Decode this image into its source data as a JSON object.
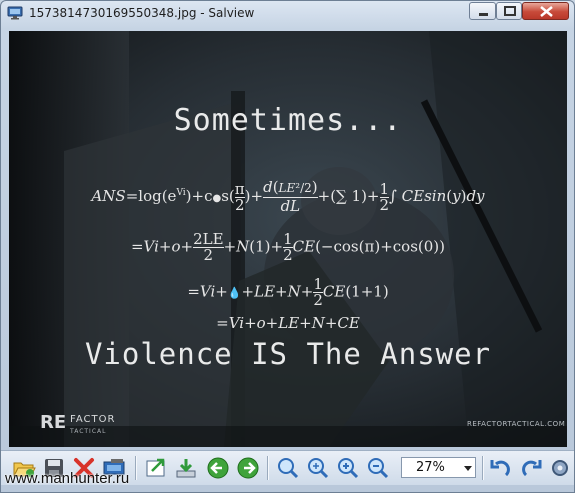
{
  "window": {
    "title": "1573814730169550348.jpg - Salview"
  },
  "image": {
    "headline_top": "Sometimes...",
    "math": {
      "line1_lhs": "ANS",
      "line2": "=Vi+o+",
      "line3": "=Vi+",
      "line4": "=Vi+o+LE+N+CE"
    },
    "headline_bottom": "Violence IS The Answer",
    "logo": {
      "re": "RE",
      "factor": "FACTOR",
      "sub": "TACTICAL"
    },
    "watermark_url": "REFACTORTACTICAL.COM"
  },
  "toolbar": {
    "zoom_value": "27%",
    "icons": [
      "open-folder-icon",
      "save-icon",
      "delete-icon",
      "screen-icon",
      "export-icon",
      "download-icon",
      "previous-icon",
      "next-icon",
      "zoom-icon",
      "zoom-in-icon",
      "zoom-fit-icon",
      "zoom-out-icon",
      "rotate-left-icon",
      "rotate-right-icon",
      "settings-icon"
    ]
  },
  "overlay": {
    "site_label": "www.manhunter.ru"
  }
}
